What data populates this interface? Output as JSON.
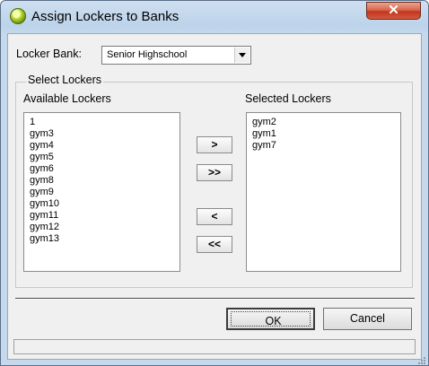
{
  "window": {
    "title": "Assign Lockers to Banks",
    "close_glyph": "✕"
  },
  "locker_bank": {
    "label": "Locker Bank:",
    "selected": "Senior Highschool"
  },
  "select_group": {
    "legend": "Select Lockers"
  },
  "available": {
    "label": "Available Lockers",
    "items": [
      "1",
      "gym3",
      "gym4",
      "gym5",
      "gym6",
      "gym8",
      "gym9",
      "gym10",
      "gym11",
      "gym12",
      "gym13"
    ]
  },
  "selected": {
    "label": "Selected Lockers",
    "items": [
      "gym2",
      "gym1",
      "gym7"
    ]
  },
  "move_buttons": {
    "add": ">",
    "add_all": ">>",
    "remove": "<",
    "remove_all": "<<"
  },
  "actions": {
    "ok": "OK",
    "cancel": "Cancel"
  },
  "colors": {
    "title_gradient": "#bcd3ea",
    "close_red": "#c2361b",
    "dialog_bg": "#f0f0f0"
  }
}
